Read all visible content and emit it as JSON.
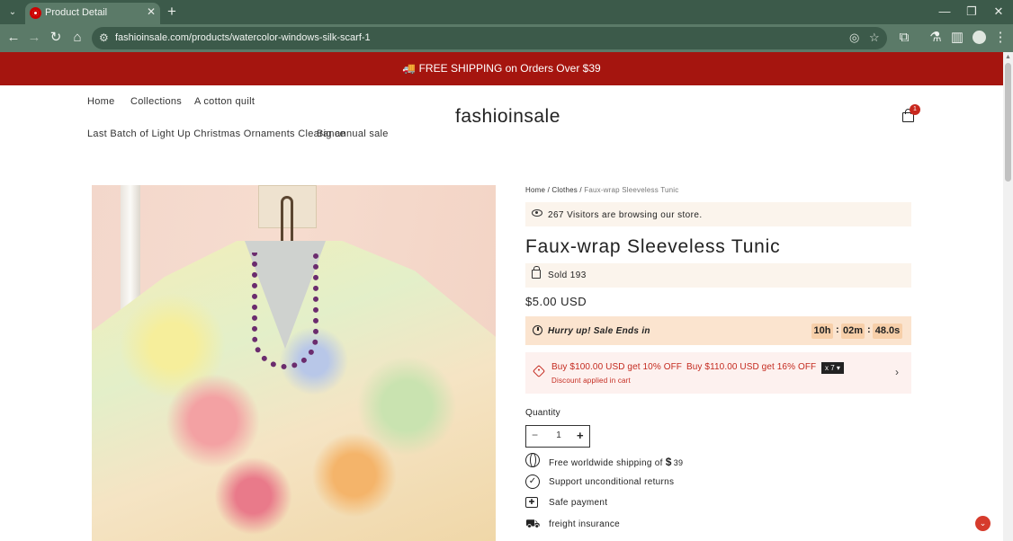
{
  "browser": {
    "tab_title": "Product Detail",
    "url": "fashioinsale.com/products/watercolor-windows-silk-scarf-1"
  },
  "announcement": {
    "icon": "truck-emoji",
    "text": "🚚 FREE SHIPPING on Orders Over $39"
  },
  "header": {
    "logo": "fashioinsale",
    "menu": [
      "Home",
      "Collections",
      "A cotton quilt",
      "Last Batch of Light Up Christmas Ornaments Clearance",
      "Big annual sale"
    ],
    "cart_count": "1"
  },
  "product": {
    "breadcrumb": {
      "home": "Home",
      "sep1": " / ",
      "category": "Clothes",
      "sep2": " / ",
      "current": "Faux-wrap Sleeveless Tunic"
    },
    "visitors_text": "267 Visitors are browsing our store.",
    "title": "Faux-wrap Sleeveless Tunic",
    "sold_text": "Sold 193",
    "price": "$5.00 USD",
    "timer": {
      "label": "Hurry up! Sale Ends in",
      "hours": "10h",
      "minutes": "02m",
      "seconds": "48.0s",
      "sep": ":"
    },
    "discount": {
      "offer1": "Buy $100.00 USD get 10% OFF",
      "offer2": "Buy $110.00 USD get 16% OFF",
      "count": "x 7 ▾",
      "subtitle": "Discount applied in cart"
    },
    "quantity": {
      "label": "Quantity",
      "value": "1"
    },
    "features": {
      "shipping": "Free worldwide shipping of",
      "shipping_currency": "$",
      "shipping_amount": "39",
      "returns": "Support unconditional returns",
      "payment": "Safe payment",
      "insurance": "freight insurance"
    }
  },
  "colors": {
    "announcement_bg": "#a5150f",
    "sale_red": "#c42a1f",
    "timer_bg": "#fbe4cf",
    "info_bg": "#fbf4ec"
  }
}
